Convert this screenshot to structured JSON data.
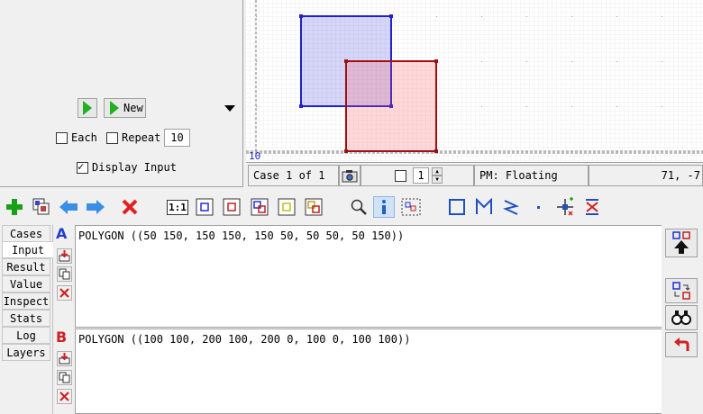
{
  "control_panel": {
    "new_label": "New",
    "each_label": "Each",
    "each_checked": false,
    "repeat_label": "Repeat",
    "repeat_checked": false,
    "repeat_value": "10",
    "display_input_label": "Display Input",
    "display_input_checked": true
  },
  "canvas": {
    "axis_label": "10",
    "polygon_a_color": "#3030e0",
    "polygon_a_fill": "#d8d8ff",
    "polygon_b_color": "#a01010",
    "polygon_b_fill": "#ffd4d4"
  },
  "status_bar": {
    "case_text": "Case 1 of 1",
    "stepper_value": "1",
    "precision_mode": "PM: Floating",
    "coords": "71, -7"
  },
  "toolbar": {
    "icons": [
      "add-icon",
      "copy-case-icon",
      "prev-icon",
      "next-icon",
      "delete-icon",
      "one-to-one-icon",
      "show-a-icon",
      "show-b-icon",
      "show-ab-icon",
      "show-result-icon",
      "show-all-icon",
      "zoom-icon",
      "info-icon",
      "select-icon",
      "square-icon",
      "m-icon",
      "z-icon",
      "point-icon",
      "pan-icon",
      "flip-icon"
    ],
    "one_to_one_label": "1:1"
  },
  "tabs": [
    {
      "label": "Cases"
    },
    {
      "label": "Input"
    },
    {
      "label": "Result"
    },
    {
      "label": "Value"
    },
    {
      "label": "Inspect"
    },
    {
      "label": "Stats"
    },
    {
      "label": "Log"
    },
    {
      "label": "Layers"
    }
  ],
  "selected_tab": "Input",
  "geometry_a": {
    "letter": "A",
    "wkt": "POLYGON ((50 150, 150 150, 150 50, 50 50, 50 150))"
  },
  "geometry_b": {
    "letter": "B",
    "wkt": "POLYGON ((100 100, 200 100, 200 0, 100 0, 100 100))"
  }
}
